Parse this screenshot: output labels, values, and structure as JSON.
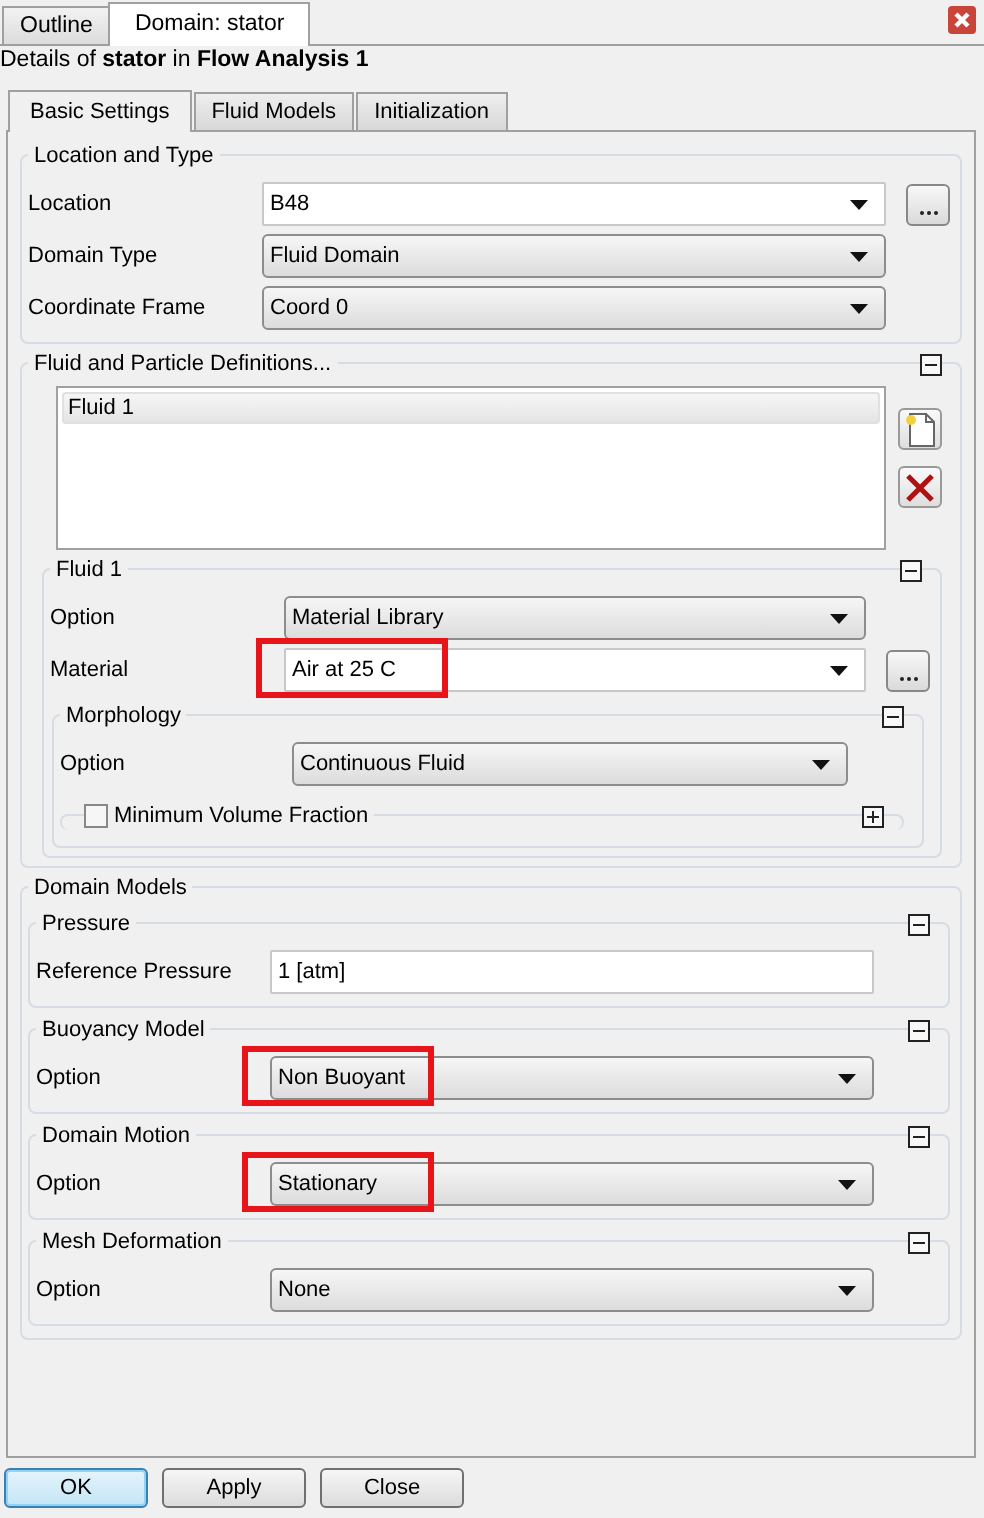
{
  "outer_tabs": [
    {
      "label": "Outline",
      "selected": false
    },
    {
      "label": "Domain: stator",
      "selected": true
    }
  ],
  "details": "Details of **stator** in **Flow Analysis 1**",
  "inner_tabs": [
    {
      "label": "Basic Settings",
      "selected": true
    },
    {
      "label": "Fluid Models",
      "selected": false
    },
    {
      "label": "Initialization",
      "selected": false
    }
  ],
  "location_and_type": {
    "title": "Location and Type",
    "rows": [
      {
        "label": "Location",
        "value": "B48",
        "kind": "editable",
        "browse": true,
        "highlighted": false
      },
      {
        "label": "Domain Type",
        "value": "Fluid Domain",
        "kind": "dropdown",
        "browse": false,
        "highlighted": false
      },
      {
        "label": "Coordinate Frame",
        "value": "Coord 0",
        "kind": "dropdown",
        "browse": false,
        "highlighted": false
      }
    ]
  },
  "fluid_definitions": {
    "title": "Fluid and Particle Definitions...",
    "expanded": true,
    "list": [
      {
        "label": "Fluid 1",
        "selected": true
      }
    ],
    "fluid": {
      "title": "Fluid 1",
      "expanded": true,
      "rows": [
        {
          "label": "Option",
          "value": "Material Library",
          "kind": "dropdown",
          "browse": false,
          "highlighted": false
        },
        {
          "label": "Material",
          "value": "Air at 25 C",
          "kind": "editable",
          "browse": true,
          "highlighted": true
        }
      ],
      "morphology": {
        "title": "Morphology",
        "expanded": true,
        "rows": [
          {
            "label": "Option",
            "value": "Continuous Fluid",
            "kind": "dropdown",
            "browse": false,
            "highlighted": false
          }
        ],
        "minimum_volume_fraction": {
          "label": "Minimum Volume Fraction",
          "checked": false,
          "expanded": false
        }
      }
    }
  },
  "domain_models": {
    "title": "Domain Models",
    "groups": [
      {
        "title": "Pressure",
        "expanded": true,
        "rows": [
          {
            "label": "Reference Pressure",
            "value": "1 [atm]",
            "kind": "text",
            "browse": false,
            "highlighted": false
          }
        ]
      },
      {
        "title": "Buoyancy Model",
        "expanded": true,
        "rows": [
          {
            "label": "Option",
            "value": "Non Buoyant",
            "kind": "dropdown",
            "browse": false,
            "highlighted": true
          }
        ]
      },
      {
        "title": "Domain Motion",
        "expanded": true,
        "rows": [
          {
            "label": "Option",
            "value": "Stationary",
            "kind": "dropdown",
            "browse": false,
            "highlighted": true
          }
        ]
      },
      {
        "title": "Mesh Deformation",
        "expanded": true,
        "rows": [
          {
            "label": "Option",
            "value": "None",
            "kind": "dropdown",
            "browse": false,
            "highlighted": false
          }
        ]
      }
    ]
  },
  "buttons": [
    {
      "label": "OK",
      "default": true
    },
    {
      "label": "Apply",
      "default": false
    },
    {
      "label": "Close",
      "default": false
    }
  ]
}
